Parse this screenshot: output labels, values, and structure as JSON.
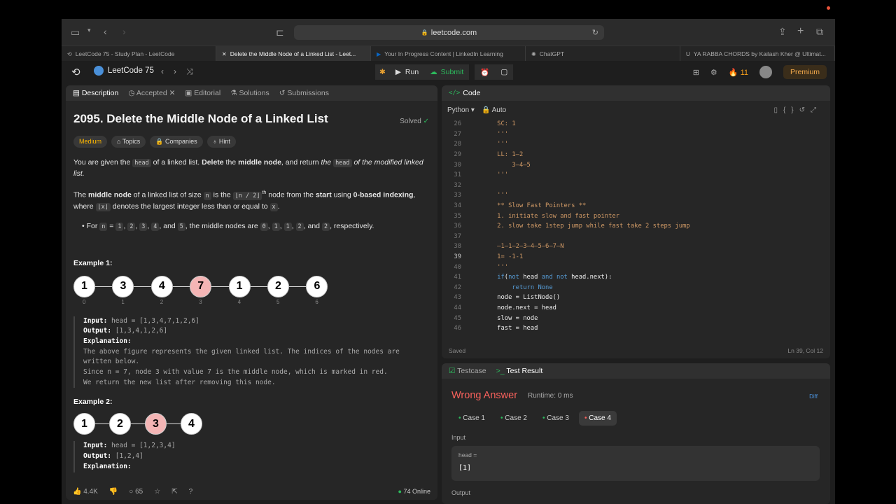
{
  "browser": {
    "url": "leetcode.com",
    "tabs": [
      {
        "label": "LeetCode 75 - Study Plan - LeetCode",
        "icon": "leetcode-icon"
      },
      {
        "label": "Delete the Middle Node of a Linked List - Leet...",
        "icon": "close-icon"
      },
      {
        "label": "Your In Progress Content | LinkedIn Learning",
        "icon": "linkedin-icon"
      },
      {
        "label": "ChatGPT",
        "icon": "chatgpt-icon"
      },
      {
        "label": "YA RABBA CHORDS by Kailash Kher @ Ultimat...",
        "icon": "ug-icon"
      }
    ]
  },
  "header": {
    "study_plan": "LeetCode 75",
    "run": "Run",
    "submit": "Submit",
    "streak": "11",
    "premium": "Premium"
  },
  "left_tabs": [
    "Description",
    "Accepted",
    "Editorial",
    "Solutions",
    "Submissions"
  ],
  "problem": {
    "title": "2095. Delete the Middle Node of a Linked List",
    "solved": "Solved",
    "difficulty": "Medium",
    "chips": [
      "Topics",
      "Companies",
      "Hint"
    ],
    "p1": {
      "a": "You are given the ",
      "code1": "head",
      "b": " of a linked list. ",
      "bold1": "Delete",
      "c": " the ",
      "bold2": "middle node",
      "d": ", and return ",
      "i1": "the ",
      "code2": "head",
      "i2": " of the modified linked list."
    },
    "p2": {
      "a": "The ",
      "bold1": "middle node",
      "b": " of a linked list of size ",
      "code1": "n",
      "c": " is the ",
      "code2": "⌊n / 2⌋",
      "sup": "th",
      "d": " node from the ",
      "bold2": "start",
      "e": " using ",
      "bold3": "0-based indexing",
      "f": ", where ",
      "code3": "⌊x⌋",
      "g": " denotes the largest integer less than or equal to ",
      "code4": "x",
      "h": "."
    },
    "bullet": {
      "a": "For ",
      "n": "n",
      "eq": " = ",
      "v1": "1",
      "v2": "2",
      "v3": "3",
      "v4": "4",
      "and": ", and ",
      "v5": "5",
      "mid": ", the middle nodes are ",
      "m1": "0",
      "m2": "1",
      "m3": "1",
      "m4": "2",
      "m5": "2",
      "end": ", respectively."
    },
    "example1": {
      "heading": "Example 1:",
      "nodes": [
        "1",
        "3",
        "4",
        "7",
        "1",
        "2",
        "6"
      ],
      "indices": [
        "0",
        "1",
        "2",
        "3",
        "4",
        "5",
        "6"
      ],
      "input_label": "Input:",
      "input": " head = [1,3,4,7,1,2,6]",
      "output_label": "Output:",
      "output": " [1,3,4,1,2,6]",
      "expl_label": "Explanation:",
      "expl1": "The above figure represents the given linked list. The indices of the nodes are",
      "expl2": "written below.",
      "expl3": "Since n = 7, node 3 with value 7 is the middle node, which is marked in red.",
      "expl4": "We return the new list after removing this node."
    },
    "example2": {
      "heading": "Example 2:",
      "nodes": [
        "1",
        "2",
        "3",
        "4"
      ],
      "input_label": "Input:",
      "input": " head = [1,2,3,4]",
      "output_label": "Output:",
      "output": " [1,2,4]",
      "expl_label": "Explanation:"
    }
  },
  "left_footer": {
    "likes": "4.4K",
    "comments": "65",
    "online": "74 Online"
  },
  "code_panel": {
    "title": "Code",
    "language": "Python",
    "mode": "Auto",
    "status": "Saved",
    "cursor": "Ln 39, Col 12",
    "lines": [
      {
        "n": "26",
        "t": "    SC: 1"
      },
      {
        "n": "27",
        "t": "    '''"
      },
      {
        "n": "28",
        "t": "    '''"
      },
      {
        "n": "29",
        "t": "    LL: 1—2"
      },
      {
        "n": "30",
        "t": "        3—4—5"
      },
      {
        "n": "31",
        "t": "    '''"
      },
      {
        "n": "32",
        "t": ""
      },
      {
        "n": "33",
        "t": "    '''"
      },
      {
        "n": "34",
        "t": "    ** Slow Fast Pointers **"
      },
      {
        "n": "35",
        "t": "    1. initiate slow and fast pointer"
      },
      {
        "n": "36",
        "t": "    2. slow take 1step jump while fast take 2 steps jump"
      },
      {
        "n": "37",
        "t": ""
      },
      {
        "n": "38",
        "t": "    —1—1—2—3—4—5—6—7—N"
      },
      {
        "n": "39",
        "t": "    1= -1-1"
      },
      {
        "n": "40",
        "t": "    '''"
      },
      {
        "n": "41",
        "t": "    if(not head and not head.next):"
      },
      {
        "n": "42",
        "t": "        return None"
      },
      {
        "n": "43",
        "t": "    node = ListNode()"
      },
      {
        "n": "44",
        "t": "    node.next = head"
      },
      {
        "n": "45",
        "t": "    slow = node"
      },
      {
        "n": "46",
        "t": "    fast = head"
      }
    ]
  },
  "test_panel": {
    "tab1": "Testcase",
    "tab2": "Test Result",
    "verdict": "Wrong Answer",
    "runtime": "Runtime: 0 ms",
    "diff": "Diff",
    "cases": [
      "Case 1",
      "Case 2",
      "Case 3",
      "Case 4"
    ],
    "input_label": "Input",
    "param": "head =",
    "value": "[1]",
    "output_label": "Output"
  }
}
